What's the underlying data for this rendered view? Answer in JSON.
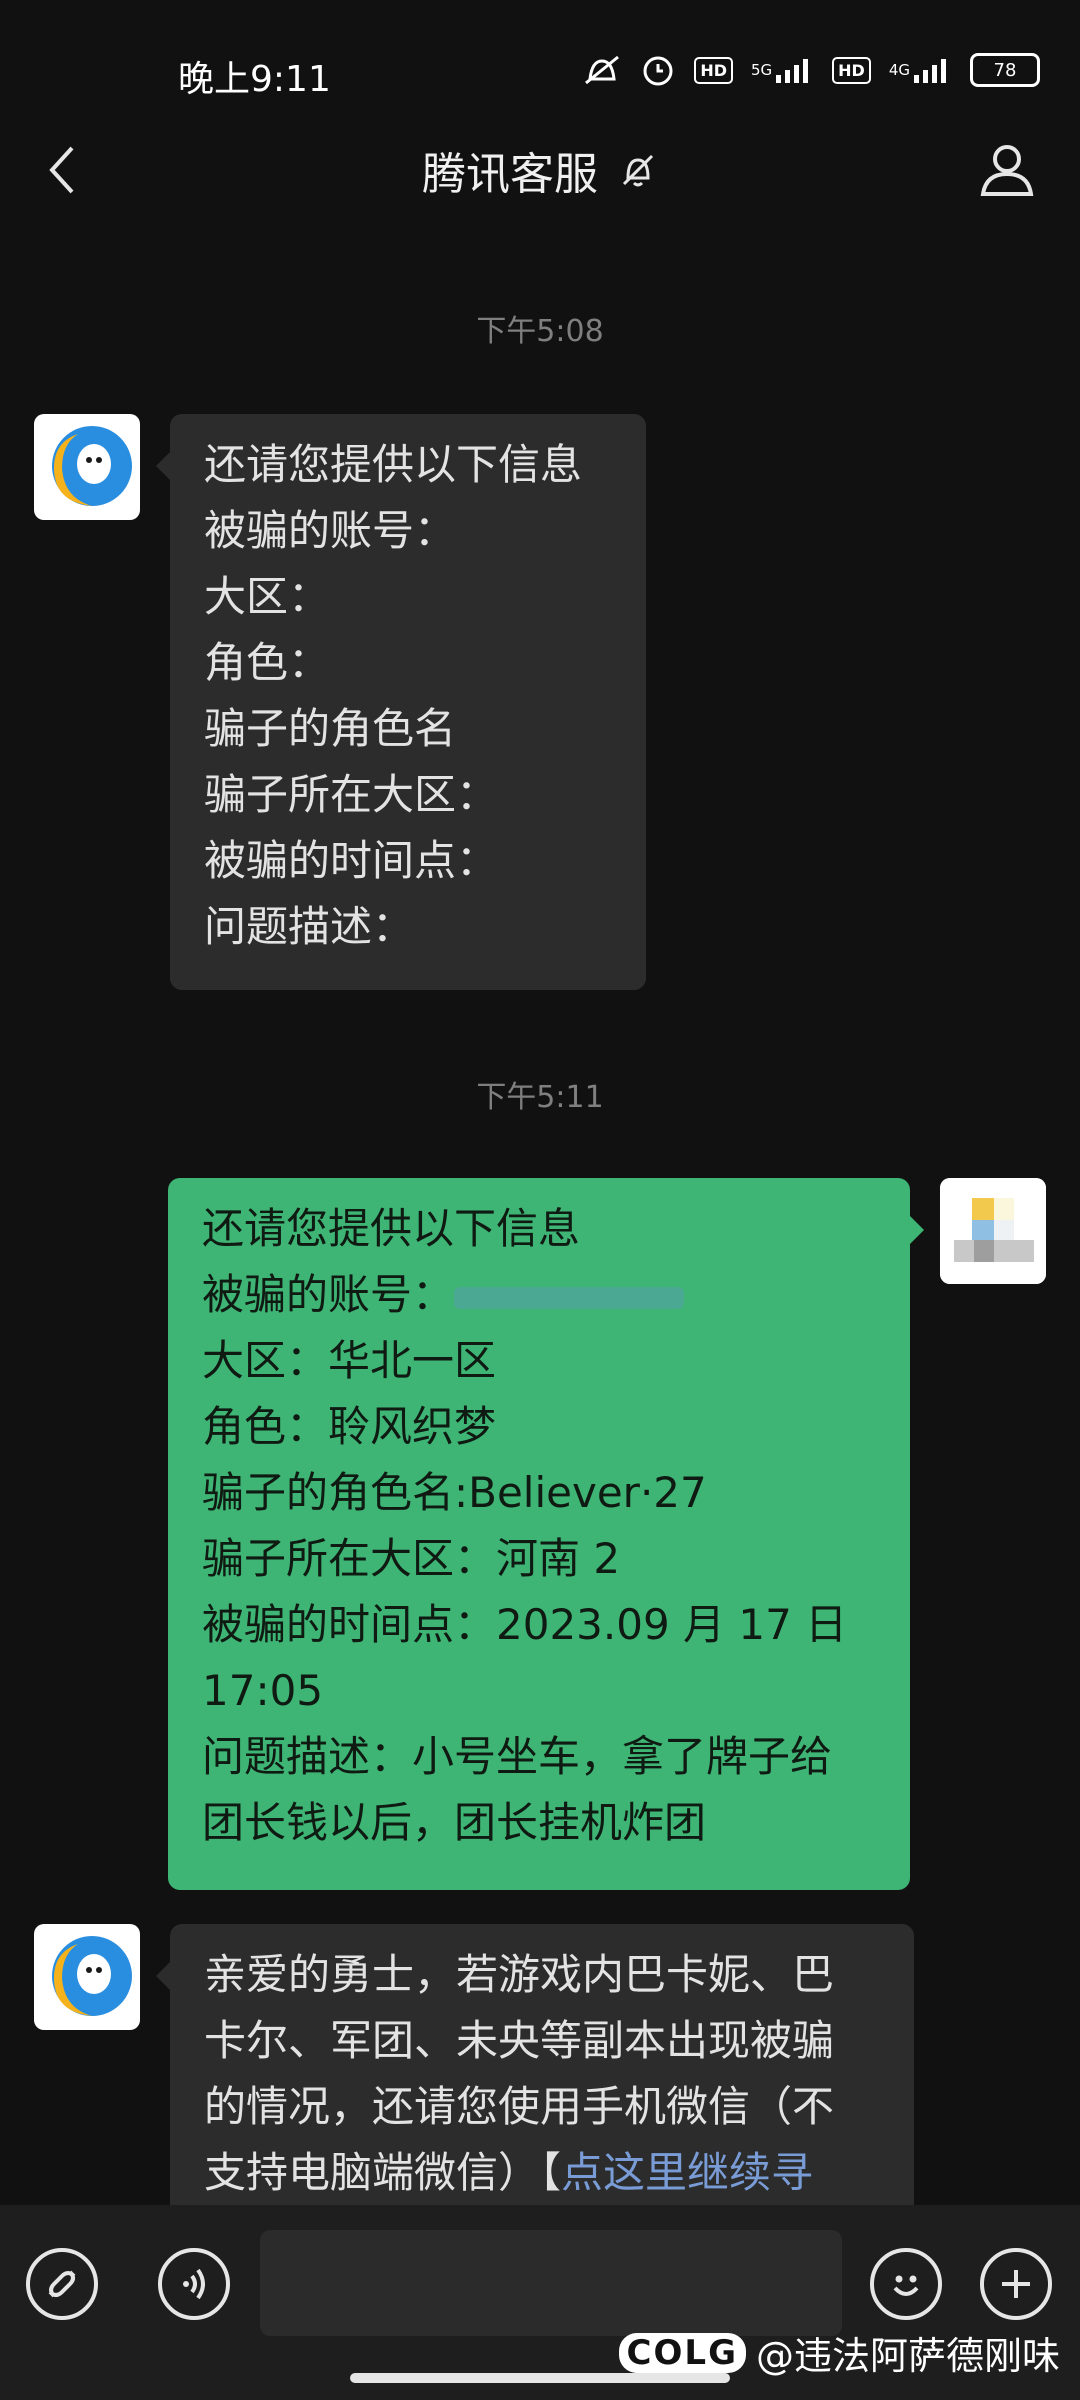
{
  "status_bar": {
    "time": "晚上9:11",
    "network_5g": "5G",
    "network_4g": "4G",
    "hd": "HD",
    "battery": "78"
  },
  "header": {
    "title": "腾讯客服"
  },
  "messages": {
    "ts1": "下午5:08",
    "m1": {
      "l1": "还请您提供以下信息",
      "l2": "被骗的账号：",
      "l3": "大区：",
      "l4": "角色：",
      "l5": "骗子的角色名",
      "l6": "骗子所在大区：",
      "l7": "被骗的时间点：",
      "l8": "问题描述："
    },
    "ts2": "下午5:11",
    "m2": {
      "l1": "还请您提供以下信息",
      "l2": "被骗的账号：",
      "l2_value": "",
      "l3": "大区：华北一区",
      "l4": "角色：聆风织梦",
      "l5": "骗子的角色名:Believer·27",
      "l6": "骗子所在大区：河南 2",
      "l7": "被骗的时间点：2023.09 月 17 日",
      "l8": "17:05",
      "l9": "问题描述：小号坐车，拿了牌子给",
      "l10": "团长钱以后，团长挂机炸团"
    },
    "m3": {
      "l1": "亲爱的勇士，若游戏内巴卡妮、巴",
      "l2": "卡尔、军团、未央等副本出现被骗",
      "l3": "的情况，还请您使用手机微信（不",
      "l4_prefix": "支持电脑端微信）【",
      "l4_link": "点这里继续寻"
    }
  },
  "input_bar": {
    "placeholder": ""
  },
  "watermark": {
    "logo": "COLG",
    "text": "@违法阿萨德刚味"
  },
  "colors": {
    "background": "#111111",
    "incoming_bubble": "#2c2c2c",
    "outgoing_bubble": "#3eb575",
    "link": "#7a9cd6"
  },
  "icons": [
    "back-arrow-icon",
    "mute-bell-icon",
    "person-icon",
    "link-icon",
    "voice-icon",
    "emoji-icon",
    "plus-icon",
    "qq-ghost-icon"
  ]
}
